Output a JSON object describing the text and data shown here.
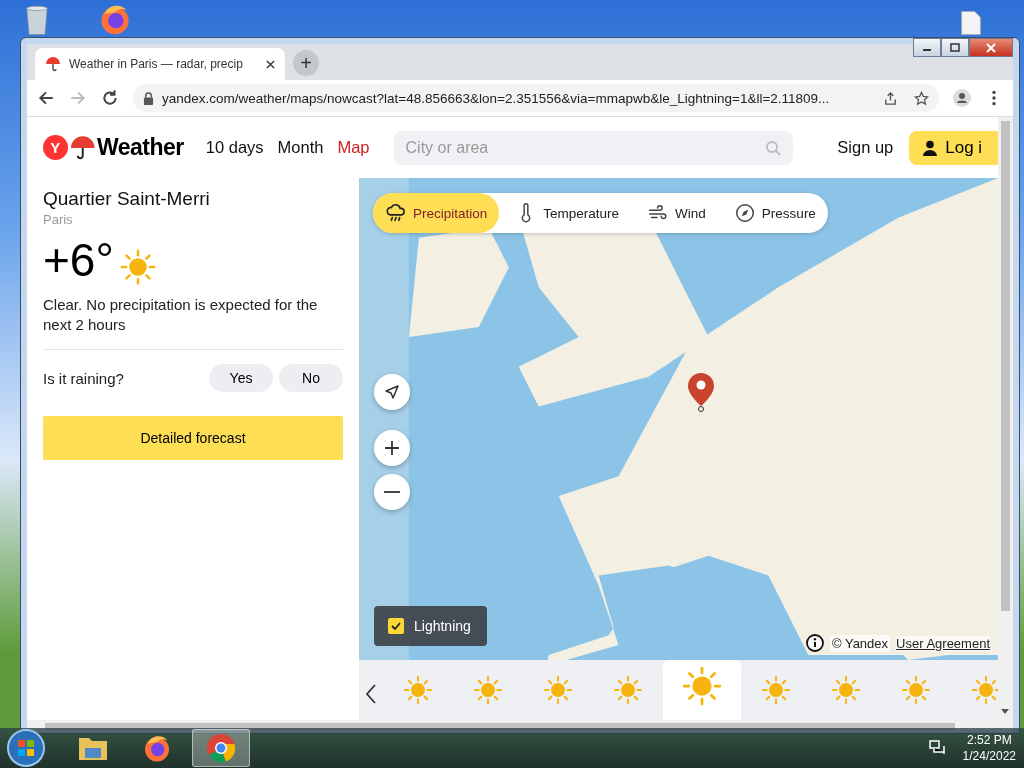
{
  "browser": {
    "tab_title": "Weather in Paris — radar, precip",
    "new_tab": "+",
    "url": "yandex.com/weather/maps/nowcast?lat=48.856663&lon=2.351556&via=mmapwb&le_Lightning=1&ll=2.11809..."
  },
  "header": {
    "logo_mark": "Y",
    "logo_text": "Weather",
    "nav": [
      {
        "label": "10 days",
        "selected": false
      },
      {
        "label": "Month",
        "selected": false
      },
      {
        "label": "Map",
        "selected": true
      }
    ],
    "search": {
      "placeholder": "City or area"
    },
    "sign_up": "Sign up",
    "log_in": "Log i"
  },
  "location": {
    "title": "Quartier Saint-Merri",
    "city": "Paris",
    "temperature": "+6°",
    "summary": "Clear. No precipitation is expected for the next 2 hours",
    "question": "Is it raining?",
    "answers": [
      "Yes",
      "No"
    ],
    "forecast_button": "Detailed forecast"
  },
  "map": {
    "layers": [
      {
        "label": "Precipitation",
        "kind": "rain",
        "selected": true
      },
      {
        "label": "Temperature",
        "kind": "thermometer",
        "selected": false
      },
      {
        "label": "Wind",
        "kind": "wind",
        "selected": false
      },
      {
        "label": "Pressure",
        "kind": "compass",
        "selected": false
      }
    ],
    "lightning": {
      "label": "Lightning",
      "checked": true
    },
    "attribution": "© Yandex",
    "agreement_link": "User Agreement",
    "timeline": [
      {
        "selected": false
      },
      {
        "selected": false
      },
      {
        "selected": false
      },
      {
        "selected": false
      },
      {
        "selected": true
      },
      {
        "selected": false
      },
      {
        "selected": false
      },
      {
        "selected": false
      },
      {
        "selected": false
      }
    ]
  },
  "taskbar": {
    "apps": [
      {
        "kind": "folder",
        "active": false
      },
      {
        "kind": "firefox",
        "active": false
      },
      {
        "kind": "chrome",
        "active": true
      }
    ],
    "time": "2:52 PM",
    "date": "1/24/2022"
  }
}
